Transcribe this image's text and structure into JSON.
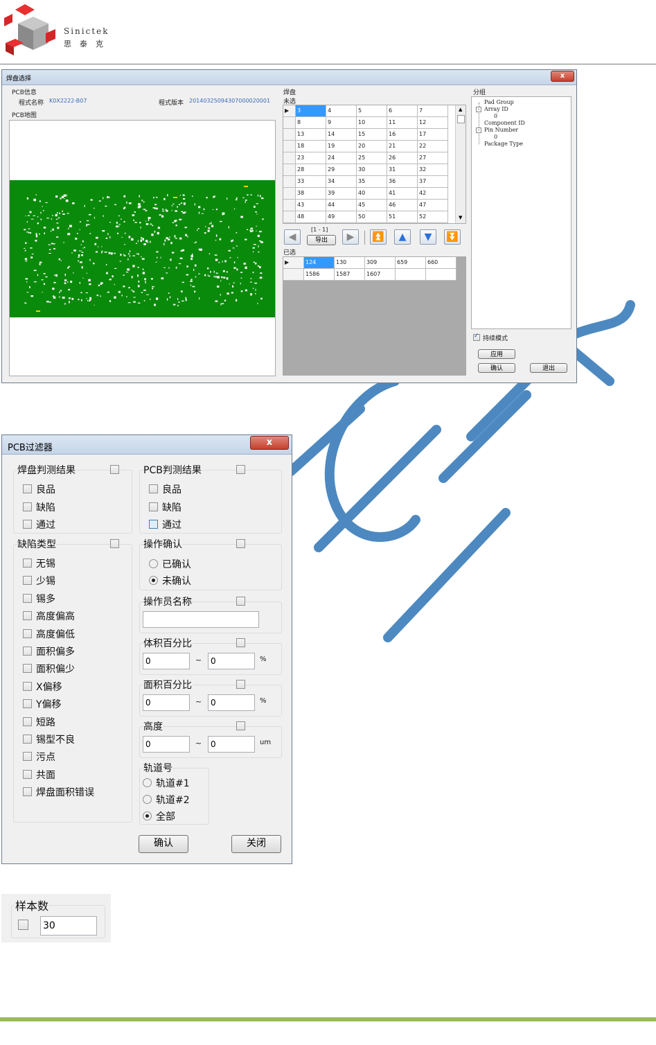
{
  "header": {
    "brand_en": "Sinictek",
    "brand_cn": "思泰克"
  },
  "pad_select": {
    "title": "焊盘选择",
    "close_label": "x",
    "pcb_info_title": "PCB信息",
    "program_name_label": "程式名称",
    "program_name_value": "K0X2222-B07",
    "program_version_label": "程式版本",
    "program_version_value": "20140325094307000020001",
    "pcb_map_title": "PCB地图",
    "pad_title": "焊盘",
    "unselected_label": "未选",
    "unselected_grid": [
      [
        "3",
        "4",
        "5",
        "6",
        "7"
      ],
      [
        "8",
        "9",
        "10",
        "11",
        "12"
      ],
      [
        "13",
        "14",
        "15",
        "16",
        "17"
      ],
      [
        "18",
        "19",
        "20",
        "21",
        "22"
      ],
      [
        "23",
        "24",
        "25",
        "26",
        "27"
      ],
      [
        "28",
        "29",
        "30",
        "31",
        "32"
      ],
      [
        "33",
        "34",
        "35",
        "36",
        "37"
      ],
      [
        "38",
        "39",
        "40",
        "41",
        "42"
      ],
      [
        "43",
        "44",
        "45",
        "46",
        "47"
      ],
      [
        "48",
        "49",
        "50",
        "51",
        "52"
      ]
    ],
    "range_label": "[1 - 1]",
    "export_label": "导出",
    "selected_label": "已选",
    "selected_grid": [
      [
        "124",
        "130",
        "309",
        "659",
        "660"
      ],
      [
        "1586",
        "1587",
        "1607",
        "",
        ""
      ]
    ],
    "group_title": "分组",
    "tree": [
      "Pad Group",
      "Array ID",
      "0",
      "Component ID",
      "Pin Number",
      "0",
      "Package Type"
    ],
    "continue_mode_label": "持续模式",
    "apply_label": "应用",
    "confirm_label": "确认",
    "exit_label": "退出"
  },
  "pcb_filter": {
    "title": "PCB过滤器",
    "close_label": "x",
    "pad_result_title": "焊盘判测结果",
    "pad_result_items": [
      "良品",
      "缺陷",
      "通过"
    ],
    "pcb_result_title": "PCB判测结果",
    "pcb_result_items": [
      "良品",
      "缺陷",
      "通过"
    ],
    "defect_type_title": "缺陷类型",
    "defect_types": [
      "无锡",
      "少锡",
      "锡多",
      "高度偏高",
      "高度偏低",
      "面积偏多",
      "面积偏少",
      "X偏移",
      "Y偏移",
      "短路",
      "锡型不良",
      "污点",
      "共面",
      "焊盘面积错误"
    ],
    "op_confirm_title": "操作确认",
    "op_confirm_options": [
      "已确认",
      "未确认"
    ],
    "operator_title": "操作员名称",
    "operator_value": "",
    "volume_title": "体积百分比",
    "volume_min": "0",
    "volume_max": "0",
    "volume_unit": "%",
    "area_title": "面积百分比",
    "area_min": "0",
    "area_max": "0",
    "area_unit": "%",
    "height_title": "高度",
    "height_min": "0",
    "height_max": "0",
    "height_unit": "um",
    "range_sep": "~",
    "track_title": "轨道号",
    "track_options": [
      "轨道#1",
      "轨道#2",
      "全部"
    ],
    "ok_label": "确认",
    "close_btn_label": "关闭"
  },
  "sample": {
    "title": "样本数",
    "value": "30"
  },
  "watermark": "Sinictek"
}
